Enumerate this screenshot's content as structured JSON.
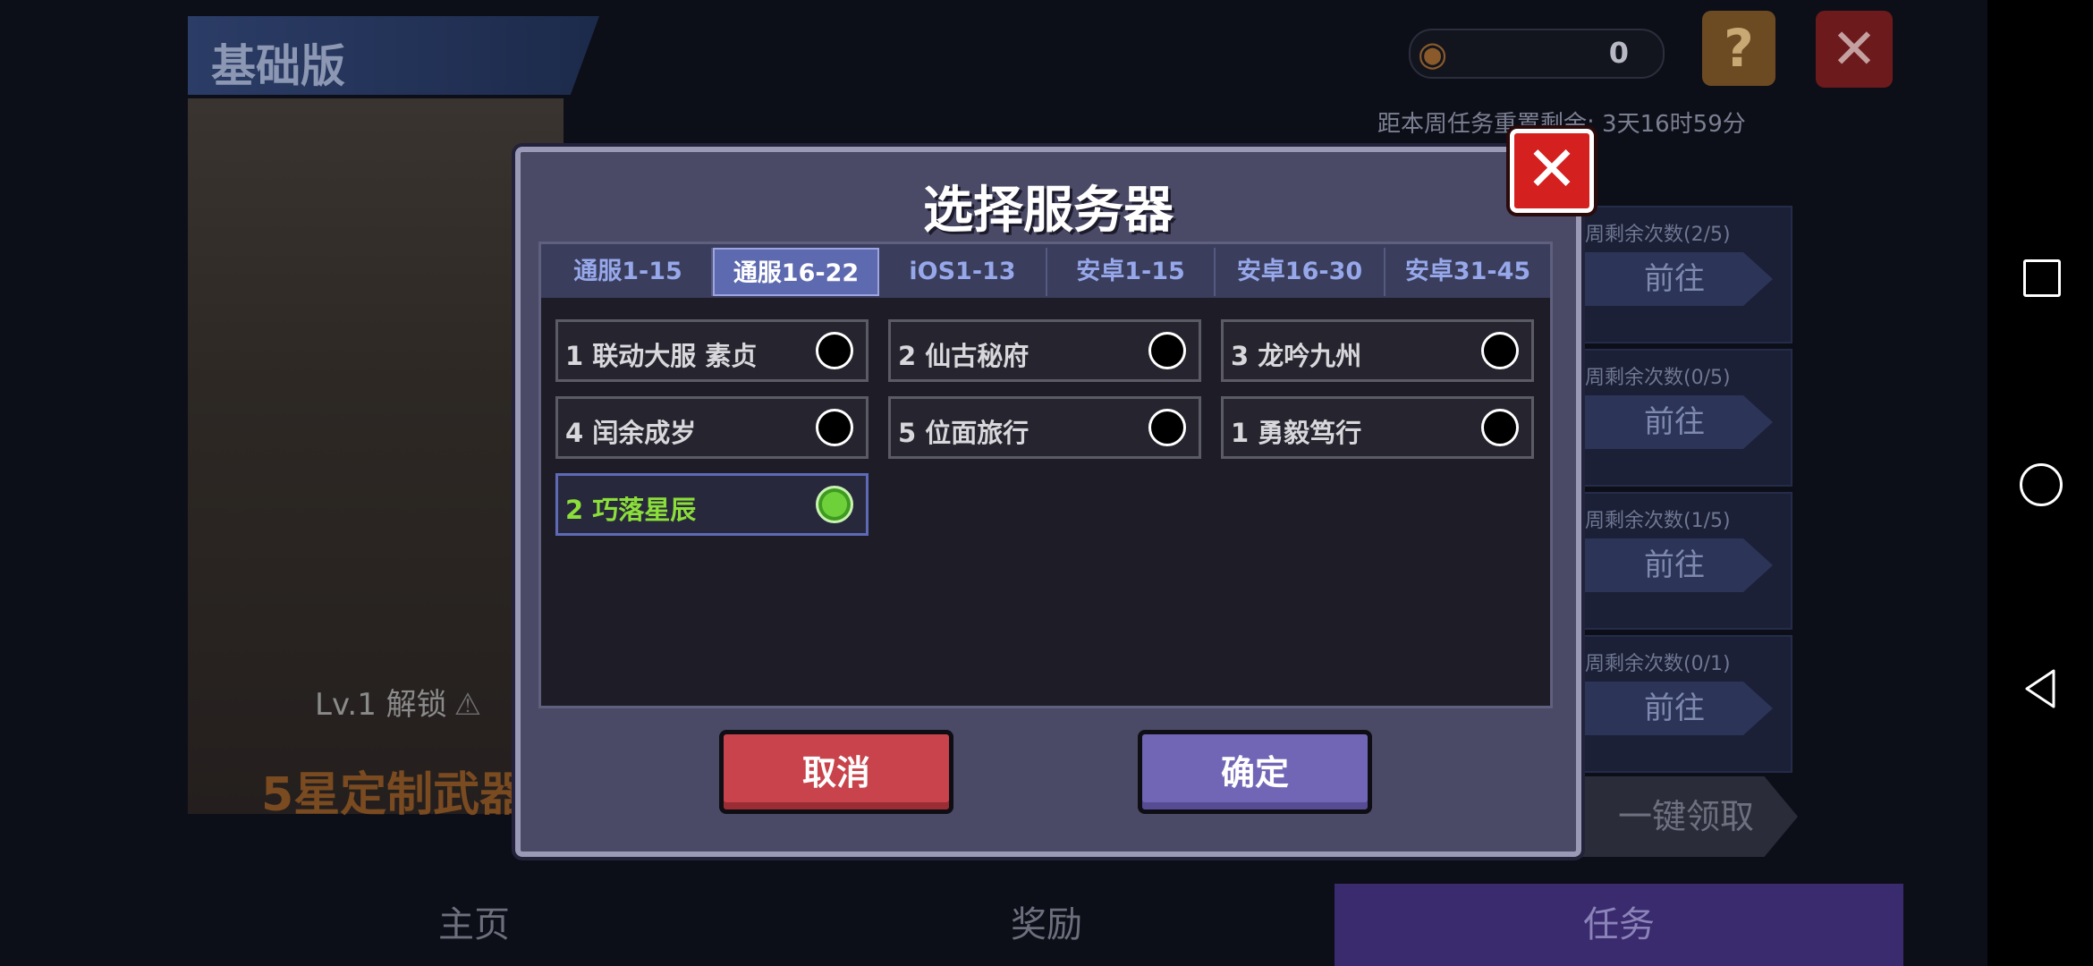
{
  "background": {
    "edition_label": "基础版",
    "currency_value": "0",
    "help_label": "?",
    "close_label": "✕",
    "weekly_timer": "距本周任务重置剩余: 3天16时59分",
    "tasks": [
      {
        "remaining": "周剩余次数(2/5)",
        "go_label": "前往"
      },
      {
        "remaining": "周剩余次数(0/5)",
        "go_label": "前往"
      },
      {
        "remaining": "周剩余次数(1/5)",
        "go_label": "前往"
      },
      {
        "remaining": "周剩余次数(0/1)",
        "go_label": "前往"
      }
    ],
    "claim_all_label": "一键领取",
    "level_unlock": "Lv.1 解锁",
    "weapon_text": "5星定制武器",
    "nav": {
      "home": "主页",
      "rewards": "奖励",
      "tasks": "任务"
    }
  },
  "dialog": {
    "title": "选择服务器",
    "close_label": "✕",
    "tabs": [
      {
        "label": "通服1-15",
        "active": false
      },
      {
        "label": "通服16-22",
        "active": true
      },
      {
        "label": "iOS1-13",
        "active": false
      },
      {
        "label": "安卓1-15",
        "active": false
      },
      {
        "label": "安卓16-30",
        "active": false
      },
      {
        "label": "安卓31-45",
        "active": false
      }
    ],
    "servers": [
      {
        "label": "1 联动大服 素贞",
        "selected": false
      },
      {
        "label": "2 仙古秘府",
        "selected": false
      },
      {
        "label": "3 龙吟九州",
        "selected": false
      },
      {
        "label": "4 闰余成岁",
        "selected": false
      },
      {
        "label": "5 位面旅行",
        "selected": false
      },
      {
        "label": "1 勇毅笃行",
        "selected": false
      },
      {
        "label": "2 巧落星辰",
        "selected": true
      }
    ],
    "cancel_label": "取消",
    "confirm_label": "确定"
  },
  "colors": {
    "selected_green": "#8bdf3a",
    "active_tab": "#5e6ab0",
    "cancel_red": "#c8434b",
    "confirm_purple": "#7166b6"
  }
}
